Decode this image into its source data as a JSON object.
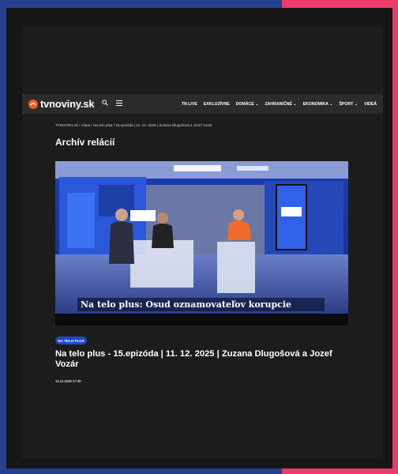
{
  "site": {
    "name": "tvnoviny.sk"
  },
  "nav": {
    "items": [
      {
        "label": "TN LIVE"
      },
      {
        "label": "EXKLUZÍVNE"
      },
      {
        "label": "DOMÁCE ⌄"
      },
      {
        "label": "ZAHRANIČNÉ ⌄"
      },
      {
        "label": "EKONOMIKA ⌄"
      },
      {
        "label": "ŠPORT ⌄"
      },
      {
        "label": "VIDEÁ"
      }
    ]
  },
  "breadcrumb": "TVNOVINY.sk / Videá / Na telo plus / 15.epizóda | 11. 12. 2025 | Zuzana Dlugošová a Jozef Vozár",
  "page_title": "Archív relácií",
  "video": {
    "caption": "Na telo plus: Osud oznamovateľov korupcie",
    "studio_logo": "natelo"
  },
  "article": {
    "tag": "NA TELO PLUS",
    "title": "Na telo plus - 15.epizóda | 11. 12. 2025 | Zuzana Dlugošová a Jozef Vozár",
    "date": "11.12.2025 17:30"
  },
  "colors": {
    "bg_left": "#24408e",
    "bg_right": "#ee3a6a",
    "tag_blue": "#1e47c4",
    "logo_orange": "#ff5a1f"
  }
}
